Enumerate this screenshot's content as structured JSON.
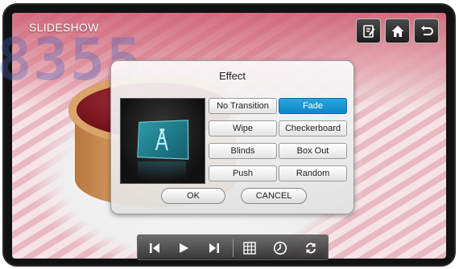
{
  "app": {
    "title": "SLIDESHOW",
    "watermark": "8355"
  },
  "top_toolbar": {
    "buttons": [
      {
        "icon": "edit-notes-icon"
      },
      {
        "icon": "home-icon"
      },
      {
        "icon": "back-icon"
      }
    ]
  },
  "dialog": {
    "title": "Effect",
    "preview_icon": "slide-preview-icon",
    "effects": [
      "No Transition",
      "Fade",
      "Wipe",
      "Checkerboard",
      "Blinds",
      "Box Out",
      "Push",
      "Random"
    ],
    "selected": "Fade",
    "ok_label": "OK",
    "cancel_label": "CANCEL"
  },
  "control_bar": {
    "buttons": [
      {
        "icon": "previous-icon"
      },
      {
        "icon": "play-icon"
      },
      {
        "icon": "next-icon"
      },
      {
        "icon": "grid-icon"
      },
      {
        "icon": "clock-icon"
      },
      {
        "icon": "repeat-icon"
      }
    ]
  },
  "colors": {
    "selected_blue": "#1796d4",
    "dialog_bg": "#eeeeee",
    "button_dark": "#1c1c1c"
  }
}
